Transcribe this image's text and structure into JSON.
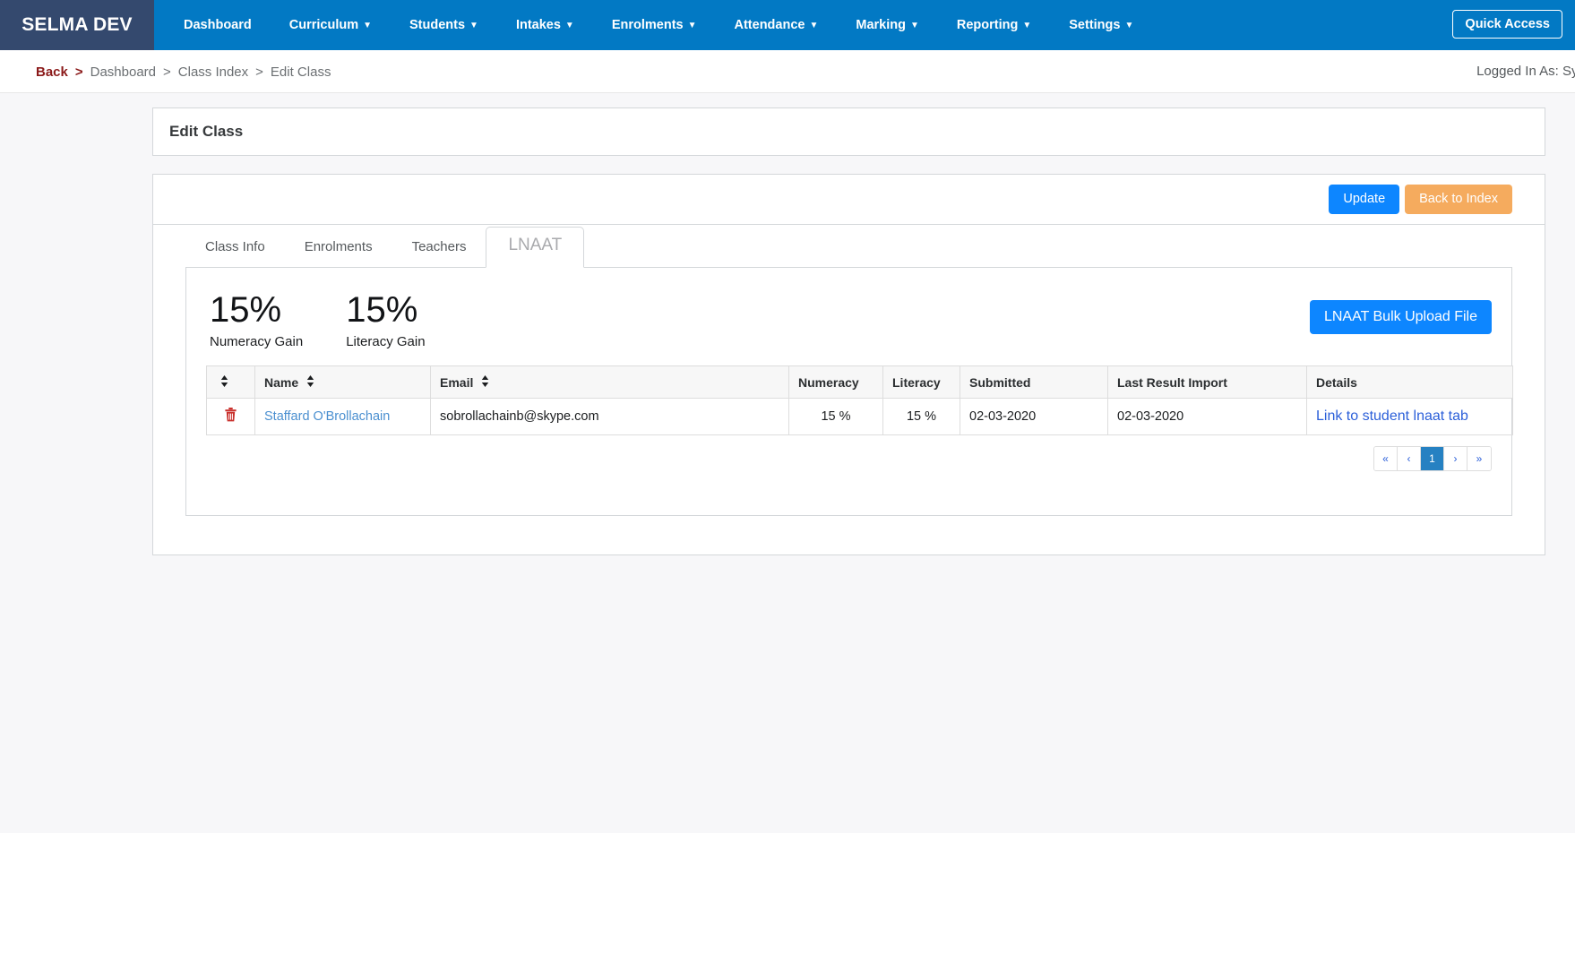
{
  "navbar": {
    "brand": "SELMA DEV",
    "items": [
      {
        "label": "Dashboard",
        "caret": false
      },
      {
        "label": "Curriculum",
        "caret": true
      },
      {
        "label": "Students",
        "caret": true
      },
      {
        "label": "Intakes",
        "caret": true
      },
      {
        "label": "Enrolments",
        "caret": true
      },
      {
        "label": "Attendance",
        "caret": true
      },
      {
        "label": "Marking",
        "caret": true
      },
      {
        "label": "Reporting",
        "caret": true
      },
      {
        "label": "Settings",
        "caret": true
      }
    ],
    "quick_access_label": "Quick Access",
    "brand_bg": "#34496e",
    "nav_bg": "#0279c4"
  },
  "breadcrumb": {
    "back_label": "Back",
    "separator": ">",
    "items": [
      {
        "label": "Dashboard"
      },
      {
        "label": "Class Index"
      },
      {
        "label": "Edit Class"
      }
    ],
    "back_color": "#8b1a1a"
  },
  "session": {
    "logged_in_as": "Logged In As: System"
  },
  "page": {
    "title": "Edit Class"
  },
  "toolbar": {
    "update_label": "Update",
    "back_to_index_label": "Back to Index",
    "update_color": "#0d86ff",
    "back_color": "#f5ab5e"
  },
  "tabs": [
    {
      "label": "Class Info",
      "active": false
    },
    {
      "label": "Enrolments",
      "active": false
    },
    {
      "label": "Teachers",
      "active": false
    },
    {
      "label": "LNAAT",
      "active": true
    }
  ],
  "stats": [
    {
      "value": "15%",
      "label": "Numeracy Gain"
    },
    {
      "value": "15%",
      "label": "Literacy Gain"
    }
  ],
  "upload": {
    "button_label": "LNAAT Bulk Upload File"
  },
  "table": {
    "headers": [
      {
        "label": "",
        "sortable": true,
        "size": "small",
        "align": "left"
      },
      {
        "label": "Name",
        "sortable": true,
        "size": "small",
        "align": "left"
      },
      {
        "label": "Email",
        "sortable": true,
        "size": "small",
        "align": "left"
      },
      {
        "label": "Numeracy",
        "sortable": false,
        "size": "small",
        "align": "center"
      },
      {
        "label": "Literacy",
        "sortable": false,
        "size": "small",
        "align": "center"
      },
      {
        "label": "Submitted",
        "sortable": false,
        "size": "big",
        "align": "left"
      },
      {
        "label": "Last Result Import",
        "sortable": false,
        "size": "big",
        "align": "left"
      },
      {
        "label": "Details",
        "sortable": false,
        "size": "big",
        "align": "left"
      }
    ],
    "rows": [
      {
        "delete_icon": "trash-icon",
        "name": "Staffard O'Brollachain",
        "email": "sobrollachainb@skype.com",
        "numeracy": "15 %",
        "literacy": "15 %",
        "submitted": "02-03-2020",
        "last_result_import": "02-03-2020",
        "details_link": "Link to student lnaat tab"
      }
    ]
  },
  "pagination": {
    "first": "«",
    "prev": "‹",
    "pages": [
      "1"
    ],
    "next": "›",
    "last": "»",
    "current": "1",
    "active_color": "#2681c2"
  }
}
